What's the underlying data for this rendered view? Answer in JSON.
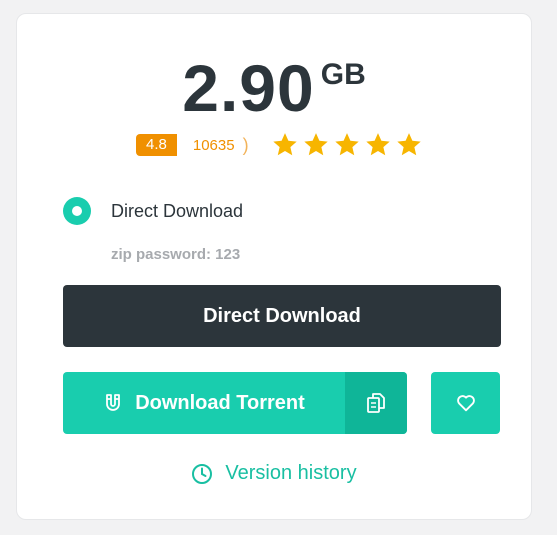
{
  "file": {
    "size_value": "2.90",
    "size_unit": "GB"
  },
  "rating": {
    "score": "4.8",
    "count": "10635",
    "count_suffix": ")",
    "stars_filled": 5,
    "stars_total": 5
  },
  "download_option": {
    "label": "Direct Download",
    "selected": true,
    "note": "zip password: 123"
  },
  "buttons": {
    "primary_label": "Direct Download",
    "torrent_label": "Download Torrent",
    "torrent_icon": "magnet-icon",
    "copy_icon": "copy-icon",
    "favorite_icon": "heart-icon"
  },
  "history": {
    "label": "Version history",
    "icon": "clock-icon"
  },
  "colors": {
    "accent": "#19cdae",
    "dark": "#2c353b",
    "rating": "#f09000",
    "star": "#f7b500"
  }
}
